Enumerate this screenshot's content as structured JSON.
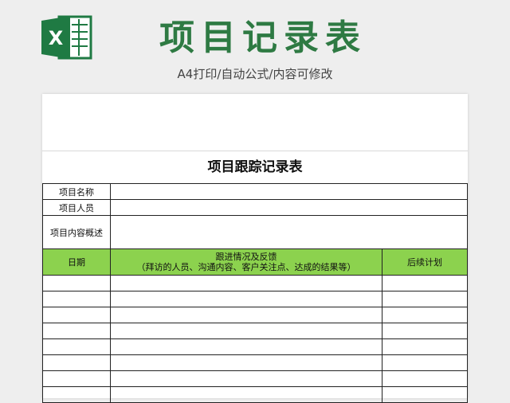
{
  "header": {
    "title": "项目记录表",
    "subtitle": "A4打印/自动公式/内容可修改",
    "logo_icon": "excel-icon",
    "logo_letter": "X",
    "brand_color": "#2e7a43"
  },
  "sheet": {
    "title": "项目跟踪记录表",
    "fields": [
      {
        "label": "项目名称",
        "value": ""
      },
      {
        "label": "项目人员",
        "value": ""
      },
      {
        "label": "项目内容概述",
        "value": ""
      }
    ],
    "columns": {
      "date": "日期",
      "progress_line1": "跟进情况及反馈",
      "progress_line2": "（拜访的人员、沟通内容、客户关注点、达成的结果等）",
      "plan": "后续计划"
    },
    "header_color": "#8cd24e",
    "rows": [
      {
        "date": "",
        "progress": "",
        "plan": ""
      },
      {
        "date": "",
        "progress": "",
        "plan": ""
      },
      {
        "date": "",
        "progress": "",
        "plan": ""
      },
      {
        "date": "",
        "progress": "",
        "plan": ""
      },
      {
        "date": "",
        "progress": "",
        "plan": ""
      },
      {
        "date": "",
        "progress": "",
        "plan": ""
      },
      {
        "date": "",
        "progress": "",
        "plan": ""
      },
      {
        "date": "",
        "progress": "",
        "plan": ""
      }
    ]
  }
}
